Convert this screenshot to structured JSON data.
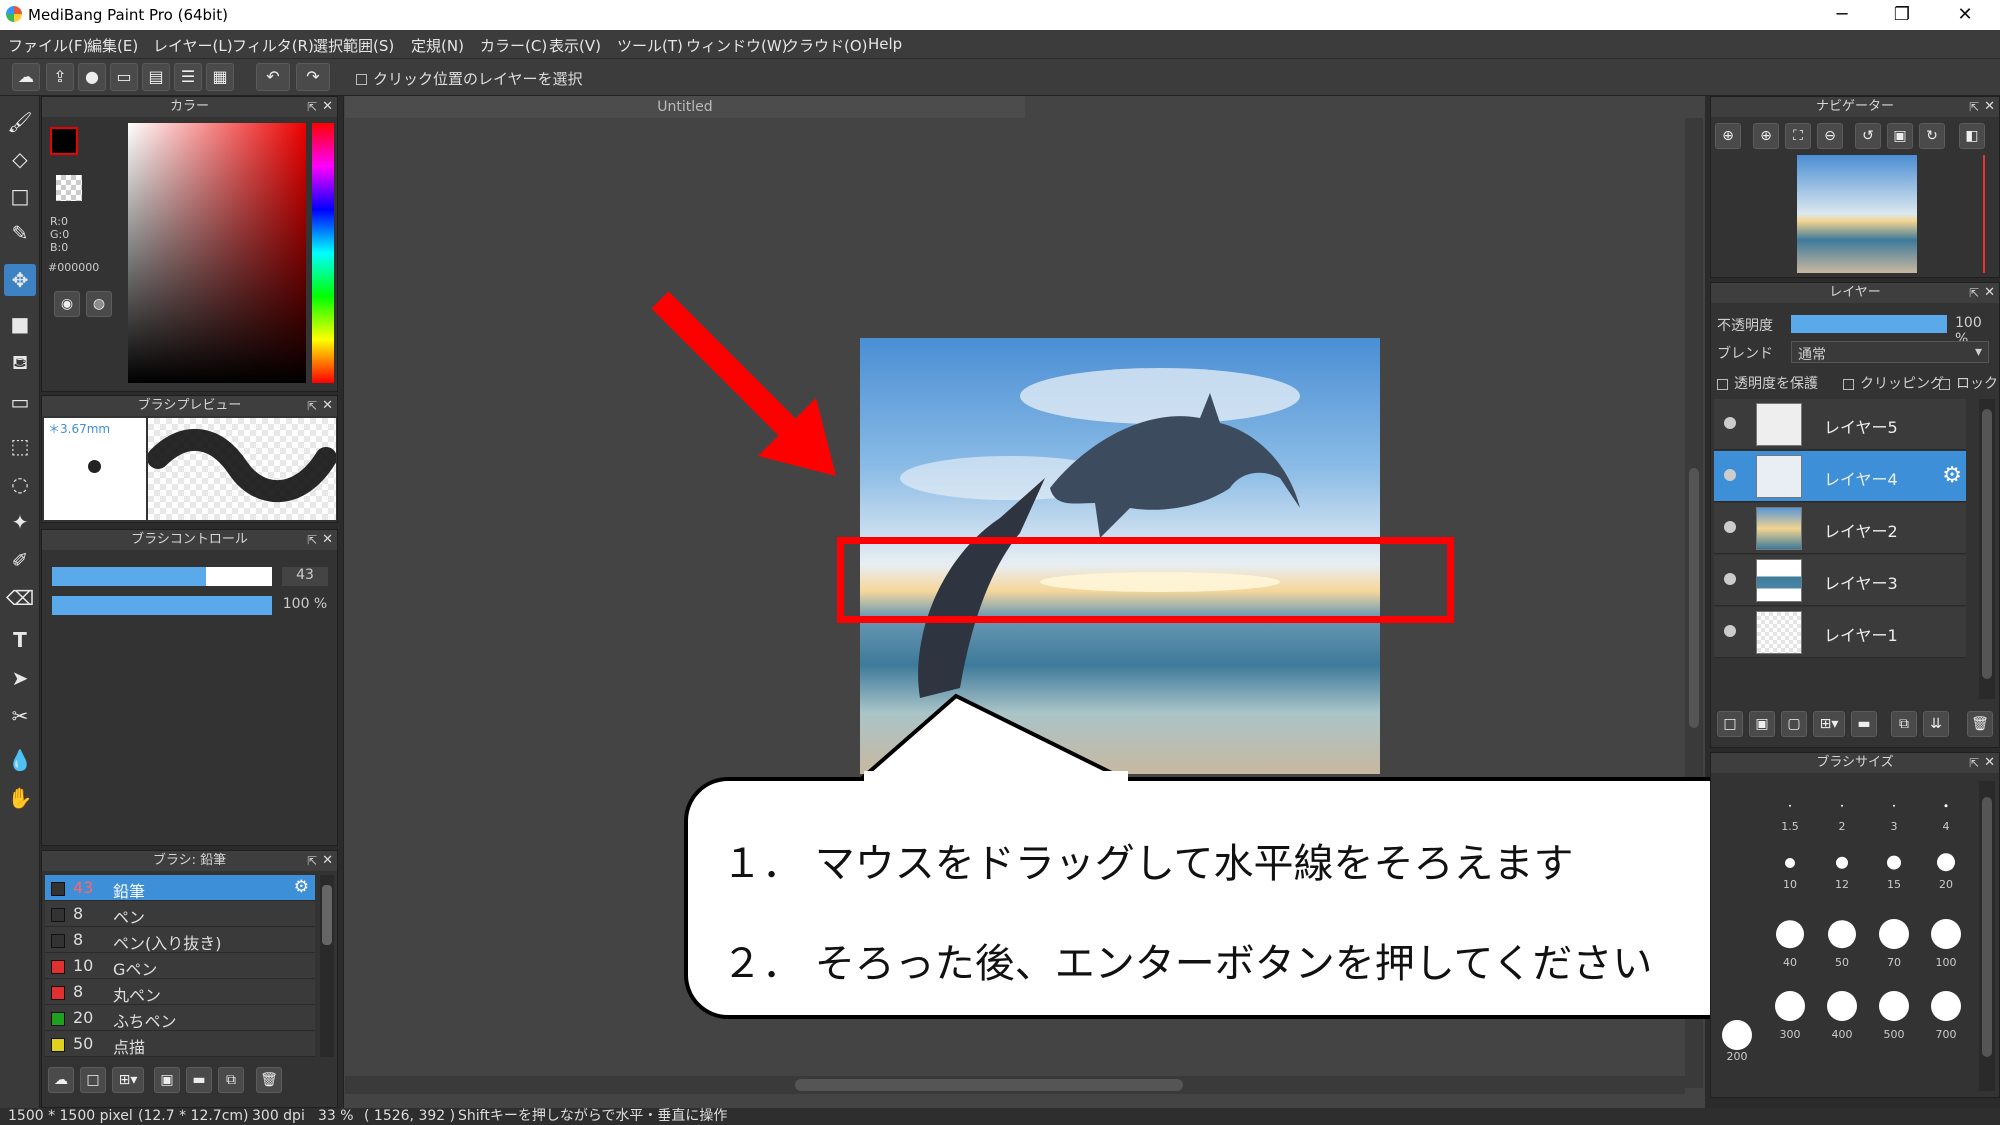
{
  "window": {
    "title": "MediBang Paint Pro (64bit)",
    "minimize": "─",
    "maximize": "❐",
    "close": "✕"
  },
  "menu": [
    "ファイル(F)",
    "編集(E)",
    "レイヤー(L)",
    "フィルタ(R)",
    "選択範囲(S)",
    "定規(N)",
    "カラー(C)",
    "表示(V)",
    "ツール(T)",
    "ウィンドウ(W)",
    "クラウド(O)",
    "Help"
  ],
  "toolbar": {
    "select_layer_checkbox": "クリック位置のレイヤーを選択"
  },
  "color_panel": {
    "title": "カラー",
    "r": "R:0",
    "g": "G:0",
    "b": "B:0",
    "hex": "#000000",
    "foreground": "#000000"
  },
  "brush_preview": {
    "title": "ブラシプレビュー",
    "size": "3.67mm"
  },
  "brush_control": {
    "title": "ブラシコントロール",
    "size_value": "43",
    "size_fraction": 0.7,
    "opacity_value": "100 %",
    "opacity_fraction": 1.0
  },
  "brush_list": {
    "title": "ブラシ: 鉛筆",
    "items": [
      {
        "size": "43",
        "name": "鉛筆",
        "color": "#333333",
        "selected": true
      },
      {
        "size": "8",
        "name": "ペン",
        "color": "#333333"
      },
      {
        "size": "8",
        "name": "ペン(入り抜き)",
        "color": "#333333"
      },
      {
        "size": "10",
        "name": "Gペン",
        "color": "#e03030"
      },
      {
        "size": "8",
        "name": "丸ペン",
        "color": "#e03030"
      },
      {
        "size": "20",
        "name": "ふちペン",
        "color": "#20a020"
      },
      {
        "size": "50",
        "name": "点描",
        "color": "#e0d020"
      }
    ]
  },
  "document": {
    "tab": "Untitled"
  },
  "navigator": {
    "title": "ナビゲーター"
  },
  "layers": {
    "title": "レイヤー",
    "opacity_label": "不透明度",
    "opacity_value": "100 %",
    "blend_label": "ブレンド",
    "blend_value": "通常",
    "protect_alpha": "透明度を保護",
    "clipping": "クリッピング",
    "lock": "ロック",
    "items": [
      {
        "name": "レイヤー5"
      },
      {
        "name": "レイヤー4",
        "selected": true
      },
      {
        "name": "レイヤー2"
      },
      {
        "name": "レイヤー3"
      },
      {
        "name": "レイヤー1"
      }
    ]
  },
  "brush_size": {
    "title": "ブラシサイズ",
    "rows": [
      [
        "1.5",
        "2",
        "3",
        "4"
      ],
      [
        "10",
        "12",
        "15",
        "20"
      ],
      [
        "40",
        "50",
        "70",
        "100"
      ],
      [
        "300",
        "400",
        "500",
        "700"
      ]
    ],
    "partial": [
      "200"
    ]
  },
  "callout": {
    "line1": "１． マウスをドラッグして水平線をそろえます",
    "line2": "２． そろった後、エンターボタンを押してください"
  },
  "status": {
    "pixels": "1500 * 1500 pixel",
    "size": "(12.7 * 12.7cm)",
    "dpi": "300 dpi",
    "zoom": "33 %",
    "coords": "( 1526, 392 )",
    "hint": "Shiftキーを押しながらで水平・垂直に操作"
  }
}
